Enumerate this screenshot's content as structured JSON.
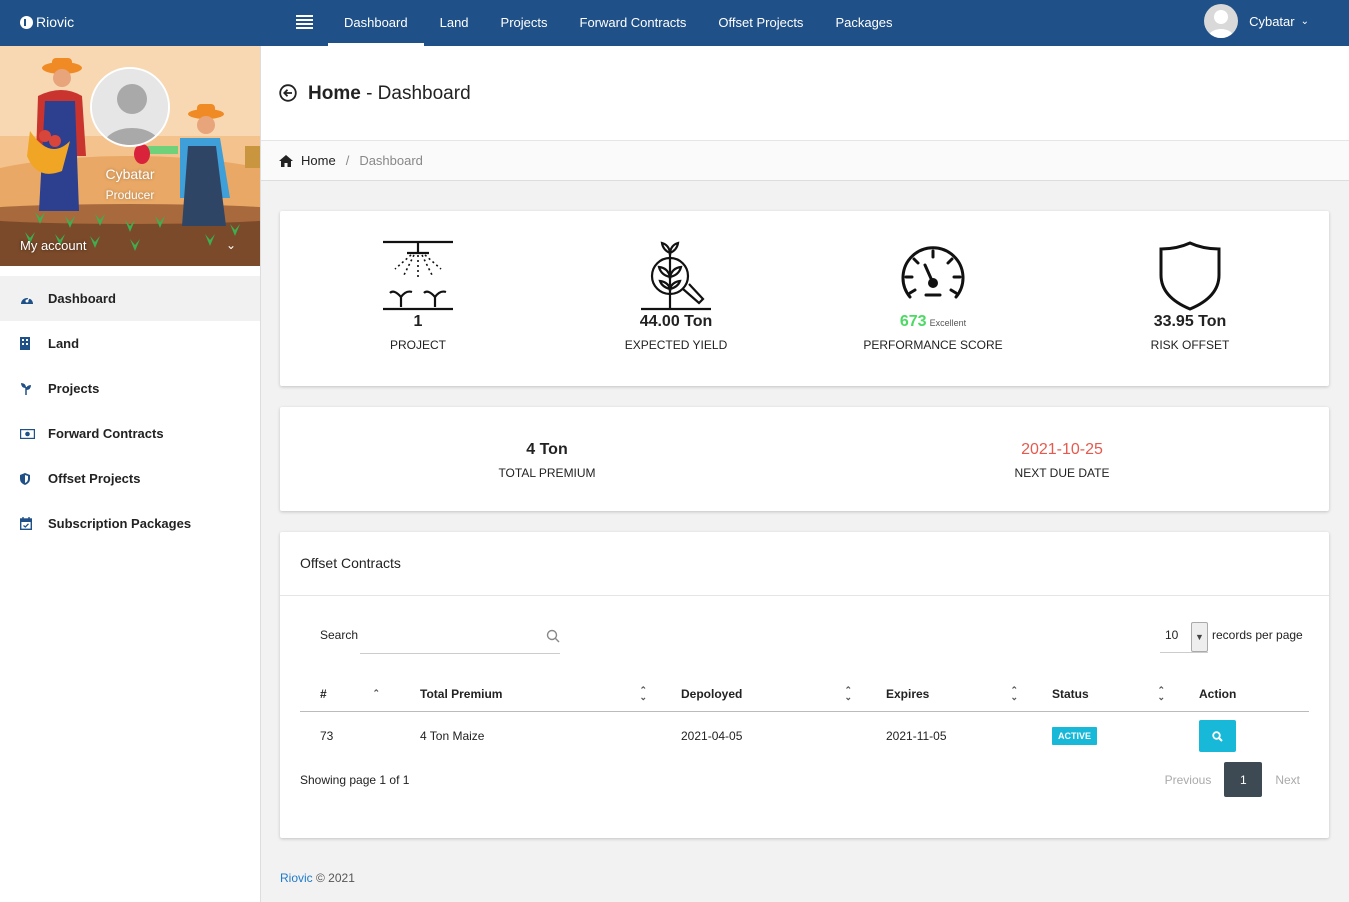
{
  "app": {
    "name": "Riovic"
  },
  "nav": {
    "items": [
      "Dashboard",
      "Land",
      "Projects",
      "Forward Contracts",
      "Offset Projects",
      "Packages"
    ],
    "active": "Dashboard"
  },
  "user": {
    "name": "Cybatar"
  },
  "sidebar": {
    "profile_name": "Cybatar",
    "profile_role": "Producer",
    "my_account": "My account",
    "items": [
      {
        "label": "Dashboard",
        "icon": "dashboard-icon"
      },
      {
        "label": "Land",
        "icon": "building-icon"
      },
      {
        "label": "Projects",
        "icon": "seedling-icon"
      },
      {
        "label": "Forward Contracts",
        "icon": "money-bill-icon"
      },
      {
        "label": "Offset Projects",
        "icon": "shield-icon"
      },
      {
        "label": "Subscription Packages",
        "icon": "calendar-check-icon"
      }
    ]
  },
  "header": {
    "title_bold": "Home",
    "title_rest": " - Dashboard"
  },
  "breadcrumb": {
    "home": "Home",
    "separator": "/",
    "current": "Dashboard"
  },
  "stats": {
    "project": {
      "value": "1",
      "label": "PROJECT"
    },
    "yield": {
      "value": "44.00 Ton",
      "label": "EXPECTED YIELD"
    },
    "performance": {
      "value": "673",
      "note": "Excellent",
      "label": "PERFORMANCE SCORE",
      "color": "#4cd964"
    },
    "risk": {
      "value": "33.95 Ton",
      "label": "RISK OFFSET"
    }
  },
  "premium": {
    "total": {
      "value": "4 Ton",
      "label": "TOTAL PREMIUM"
    },
    "due": {
      "value": "2021-10-25",
      "label": "NEXT DUE DATE",
      "color": "#e55a4e"
    }
  },
  "contracts": {
    "title": "Offset Contracts",
    "search_label": "Search",
    "search_value": "",
    "records_per_page": "10",
    "records_per_page_label": "records per page",
    "columns": [
      "#",
      "Total Premium",
      "Depoloyed",
      "Expires",
      "Status",
      "Action"
    ],
    "rows": [
      {
        "id": "73",
        "premium": "4 Ton Maize",
        "deployed": "2021-04-05",
        "expires": "2021-11-05",
        "status": "ACTIVE"
      }
    ],
    "showing": "Showing page 1 of 1",
    "pager": {
      "prev": "Previous",
      "current": "1",
      "next": "Next"
    }
  },
  "footer": {
    "brand": "Riovic",
    "text": " © 2021"
  },
  "colors": {
    "topbar": "#1f5087",
    "accent": "#17b8d8",
    "pager_active": "#3d4a53"
  }
}
